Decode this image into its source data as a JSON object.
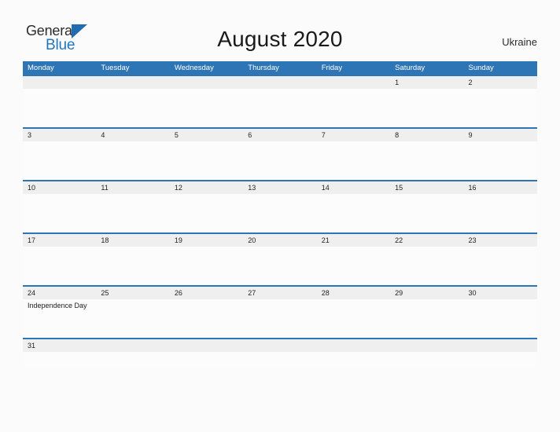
{
  "brand": {
    "name_top": "General",
    "name_bottom": "Blue",
    "color_blue": "#2176bd",
    "color_dark": "#2b2b2b"
  },
  "header": {
    "title": "August 2020",
    "locale": "Ukraine"
  },
  "theme": {
    "header_blue": "#2e75b6",
    "row_line_blue": "#2e75b6",
    "date_strip_gray": "#efefef",
    "page_background": "#fbfbfb"
  },
  "calendar": {
    "month": "August",
    "year": "2020",
    "weekday_headers": [
      "Monday",
      "Tuesday",
      "Wednesday",
      "Thursday",
      "Friday",
      "Saturday",
      "Sunday"
    ],
    "weeks": [
      [
        {
          "date": "",
          "events": []
        },
        {
          "date": "",
          "events": []
        },
        {
          "date": "",
          "events": []
        },
        {
          "date": "",
          "events": []
        },
        {
          "date": "",
          "events": []
        },
        {
          "date": "1",
          "events": []
        },
        {
          "date": "2",
          "events": []
        }
      ],
      [
        {
          "date": "3",
          "events": []
        },
        {
          "date": "4",
          "events": []
        },
        {
          "date": "5",
          "events": []
        },
        {
          "date": "6",
          "events": []
        },
        {
          "date": "7",
          "events": []
        },
        {
          "date": "8",
          "events": []
        },
        {
          "date": "9",
          "events": []
        }
      ],
      [
        {
          "date": "10",
          "events": []
        },
        {
          "date": "11",
          "events": []
        },
        {
          "date": "12",
          "events": []
        },
        {
          "date": "13",
          "events": []
        },
        {
          "date": "14",
          "events": []
        },
        {
          "date": "15",
          "events": []
        },
        {
          "date": "16",
          "events": []
        }
      ],
      [
        {
          "date": "17",
          "events": []
        },
        {
          "date": "18",
          "events": []
        },
        {
          "date": "19",
          "events": []
        },
        {
          "date": "20",
          "events": []
        },
        {
          "date": "21",
          "events": []
        },
        {
          "date": "22",
          "events": []
        },
        {
          "date": "23",
          "events": []
        }
      ],
      [
        {
          "date": "24",
          "events": [
            "Independence Day"
          ]
        },
        {
          "date": "25",
          "events": []
        },
        {
          "date": "26",
          "events": []
        },
        {
          "date": "27",
          "events": []
        },
        {
          "date": "28",
          "events": []
        },
        {
          "date": "29",
          "events": []
        },
        {
          "date": "30",
          "events": []
        }
      ],
      [
        {
          "date": "31",
          "events": []
        },
        {
          "date": "",
          "events": []
        },
        {
          "date": "",
          "events": []
        },
        {
          "date": "",
          "events": []
        },
        {
          "date": "",
          "events": []
        },
        {
          "date": "",
          "events": []
        },
        {
          "date": "",
          "events": []
        }
      ]
    ]
  }
}
